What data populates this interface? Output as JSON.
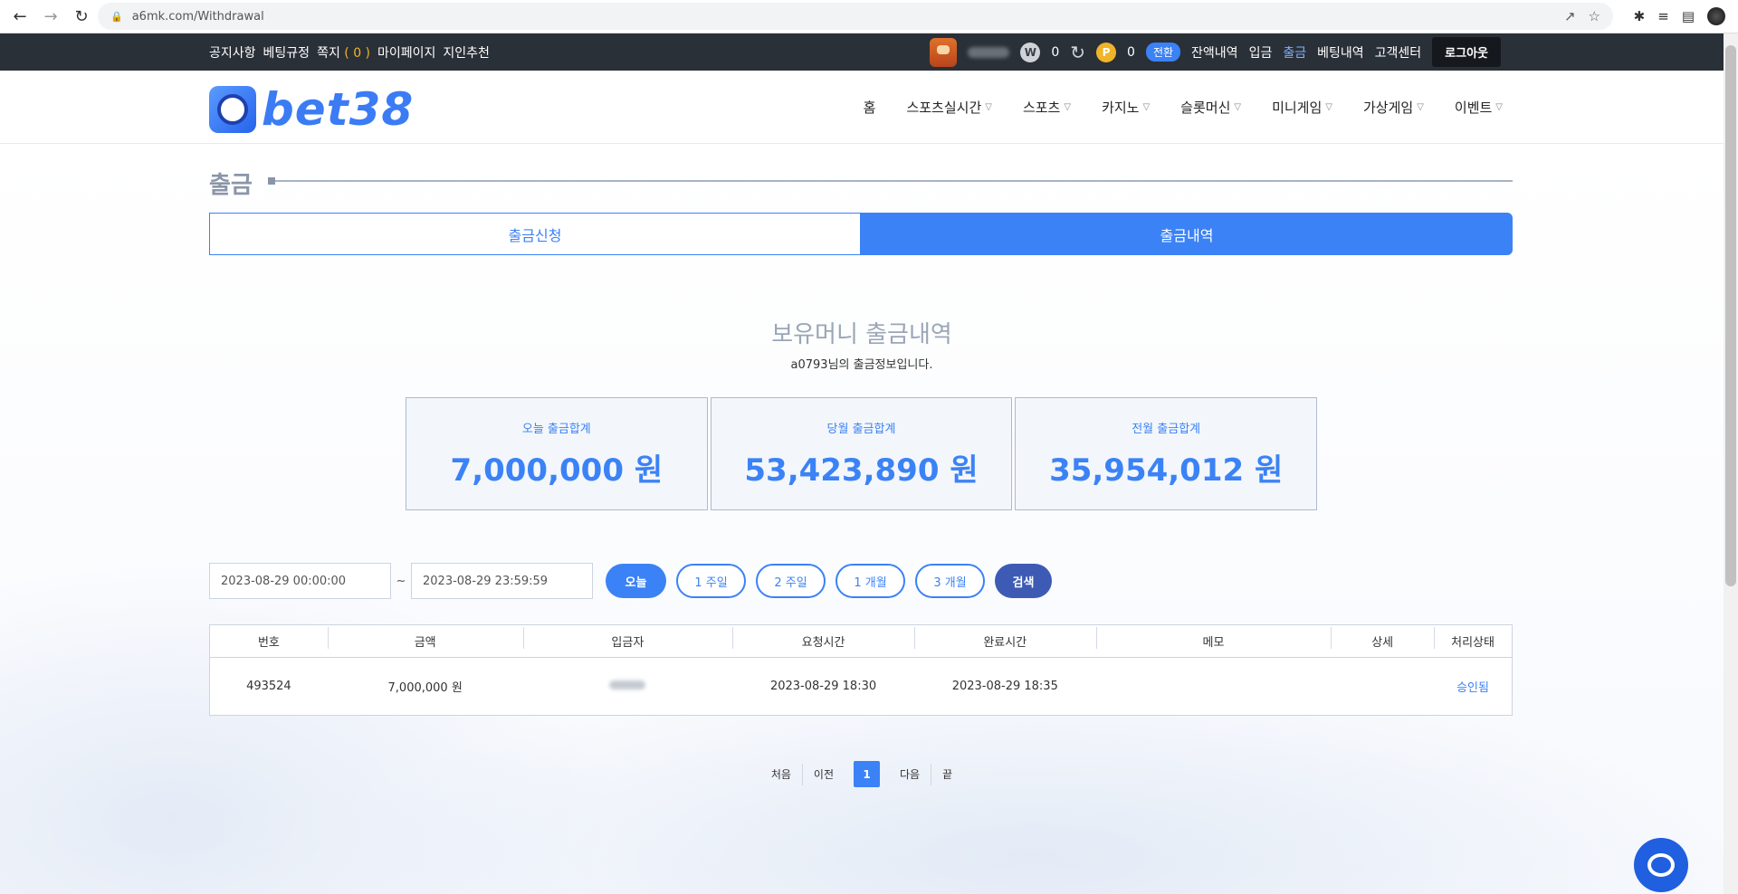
{
  "browser": {
    "url": "a6mk.com/Withdrawal"
  },
  "topbar": {
    "left_items": [
      "공지사항",
      "베팅규정",
      "쪽지"
    ],
    "message_count": "( 0 )",
    "left_items_after": [
      "마이페이지",
      "지인추천"
    ],
    "w_coin_label": "W",
    "w_balance": "0",
    "p_coin_label": "P",
    "p_balance": "0",
    "convert_label": "전환",
    "right_links": [
      "잔액내역",
      "입금",
      "출금",
      "베팅내역",
      "고객센터"
    ],
    "active_link": "출금",
    "logout_label": "로그아웃"
  },
  "header": {
    "logo_text": "bet38",
    "nav": [
      {
        "label": "홈",
        "has_dropdown": false
      },
      {
        "label": "스포츠실시간",
        "has_dropdown": true
      },
      {
        "label": "스포츠",
        "has_dropdown": true
      },
      {
        "label": "카지노",
        "has_dropdown": true
      },
      {
        "label": "슬롯머신",
        "has_dropdown": true
      },
      {
        "label": "미니게임",
        "has_dropdown": true
      },
      {
        "label": "가상게임",
        "has_dropdown": true
      },
      {
        "label": "이벤트",
        "has_dropdown": true
      }
    ]
  },
  "page": {
    "title": "출금",
    "tabs": [
      {
        "label": "출금신청",
        "active": false
      },
      {
        "label": "출금내역",
        "active": true
      }
    ],
    "section_title": "보유머니 출금내역",
    "section_subtitle": "a0793님의 출금정보입니다."
  },
  "summary": [
    {
      "label": "오늘 출금합계",
      "value": "7,000,000 원"
    },
    {
      "label": "당월 출금합계",
      "value": "53,423,890 원"
    },
    {
      "label": "전월 출금합계",
      "value": "35,954,012 원"
    }
  ],
  "filter": {
    "start_date": "2023-08-29 00:00:00",
    "separator": "~",
    "end_date": "2023-08-29 23:59:59",
    "buttons": [
      "오늘",
      "1 주일",
      "2 주일",
      "1 개월",
      "3 개월"
    ],
    "search_label": "검색"
  },
  "table": {
    "columns": [
      "번호",
      "금액",
      "입금자",
      "요청시간",
      "완료시간",
      "메모",
      "상세",
      "처리상태"
    ],
    "rows": [
      {
        "no": "493524",
        "amount": "7,000,000 원",
        "requested": "2023-08-29 18:30",
        "completed": "2023-08-29 18:35",
        "memo": "",
        "detail": "",
        "status": "승인됨"
      }
    ]
  },
  "pagination": {
    "first": "처음",
    "prev": "이전",
    "current": "1",
    "next": "다음",
    "last": "끝"
  },
  "colors": {
    "accent": "#3b82f6",
    "topbar_bg": "#2a3038",
    "search_button": "#3d5bb5"
  }
}
